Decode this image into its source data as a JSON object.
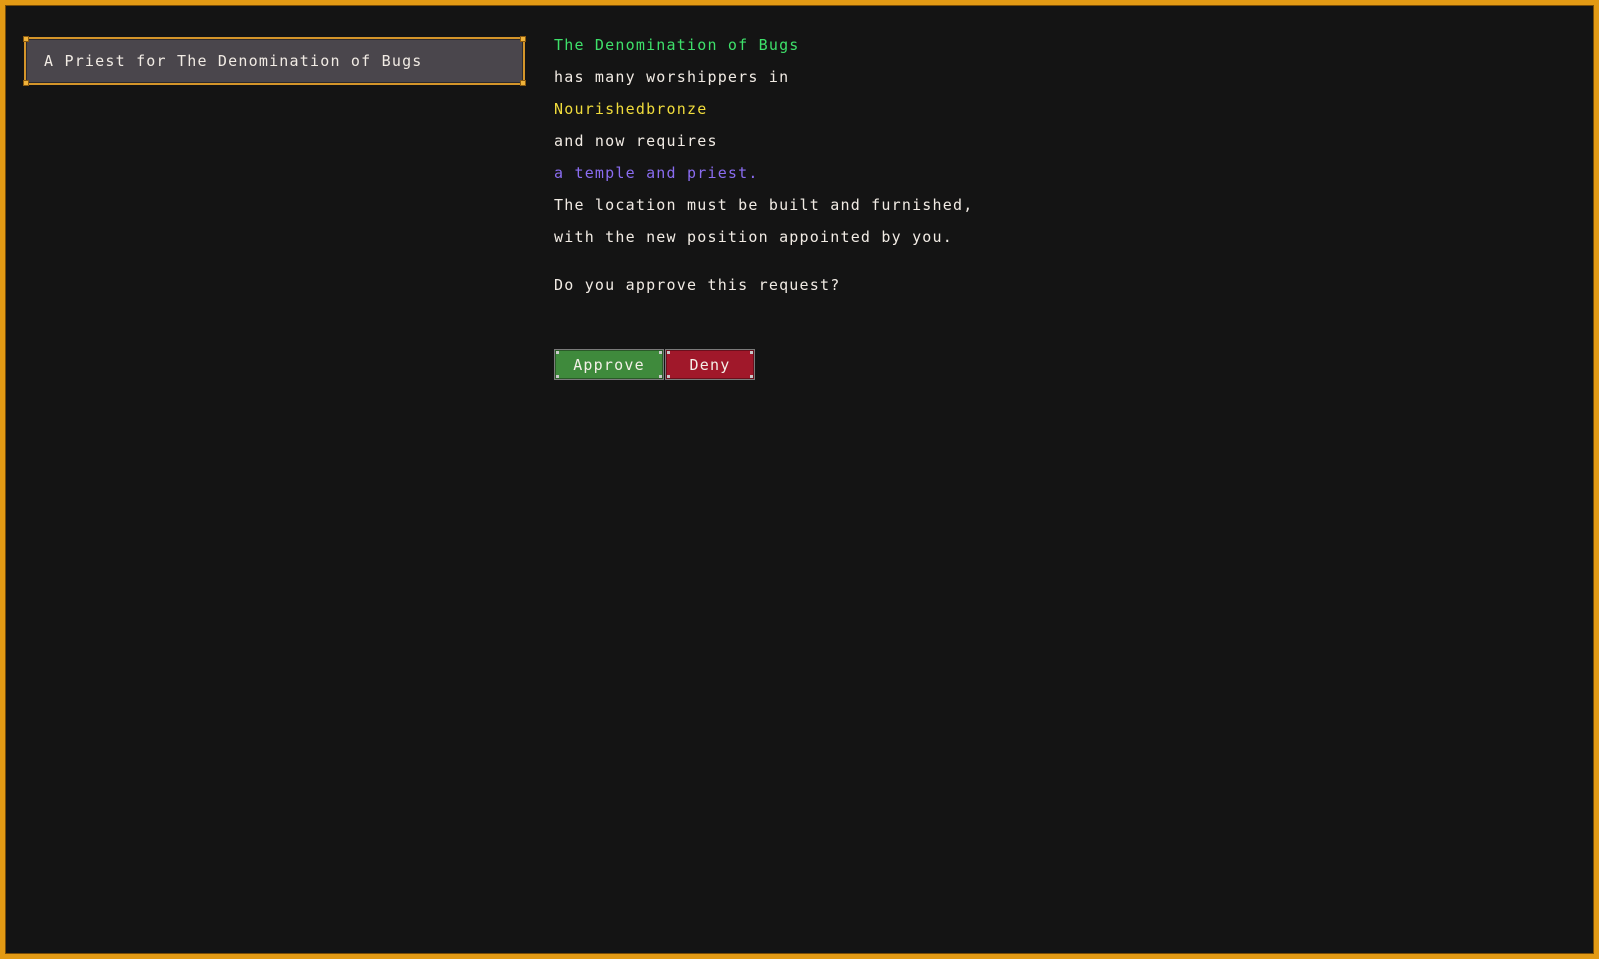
{
  "request_list": {
    "items": [
      {
        "label": "A Priest for The Denomination of Bugs"
      }
    ]
  },
  "request": {
    "lines": [
      {
        "text": "The Denomination of Bugs",
        "color": "#3ee06a"
      },
      {
        "text": "has many worshippers in",
        "color": "#f1ebe4"
      },
      {
        "text": "Nourishedbronze",
        "color": "#f0dc3c"
      },
      {
        "text": "and now requires",
        "color": "#f1ebe4"
      },
      {
        "text": "a temple and priest.",
        "color": "#8a6cf0"
      },
      {
        "text": "The location must be built and furnished,",
        "color": "#f1ebe4"
      },
      {
        "text": "with the new position appointed by you.",
        "color": "#f1ebe4"
      }
    ],
    "question": "Do you approve this request?"
  },
  "actions": {
    "approve_label": "Approve",
    "deny_label": "Deny"
  },
  "colors": {
    "frame_border": "#e39a14",
    "background": "#141414",
    "approve": "#3f8a3c",
    "deny": "#a0182a"
  }
}
